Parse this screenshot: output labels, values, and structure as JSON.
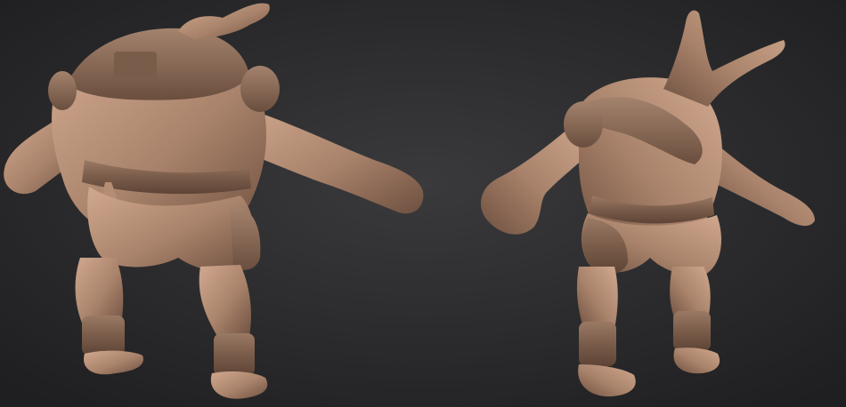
{
  "scene": {
    "kind": "3d-sculpt-render",
    "subject": "creature",
    "views": [
      "back-three-quarter",
      "front-three-quarter"
    ],
    "colors": {
      "background_center": "#3a3a3c",
      "background_edge": "#1f1f21",
      "clay_light": "#c79f85",
      "clay_mid": "#a07a62",
      "clay_dark": "#6e5040",
      "armor": "#8a6a56"
    }
  }
}
